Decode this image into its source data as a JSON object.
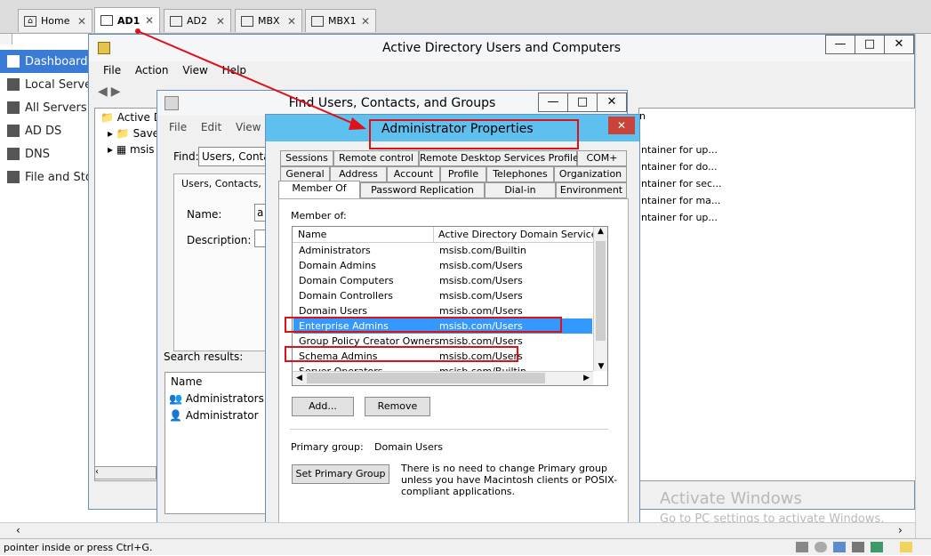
{
  "browser_tabs": [
    {
      "label": "Home",
      "active": false
    },
    {
      "label": "AD1",
      "active": true
    },
    {
      "label": "AD2",
      "active": false
    },
    {
      "label": "MBX",
      "active": false
    },
    {
      "label": "MBX1",
      "active": false
    }
  ],
  "sidebar": {
    "items": [
      {
        "label": "Dashboard",
        "selected": true
      },
      {
        "label": "Local Server"
      },
      {
        "label": "All Servers"
      },
      {
        "label": "AD DS"
      },
      {
        "label": "DNS"
      },
      {
        "label": "File and Storage Services"
      }
    ]
  },
  "aduc": {
    "title": "Active Directory Users and Computers",
    "menu": [
      "File",
      "Action",
      "View",
      "Help"
    ],
    "tree": [
      "Active D",
      "Save",
      "msis"
    ],
    "descriptions": [
      "ntainer for up...",
      "ntainer for do...",
      "ntainer for sec...",
      "ntainer for ma...",
      "ntainer for up..."
    ],
    "col_header": "n"
  },
  "find": {
    "title": "Find Users, Contacts, and Groups",
    "menu": [
      "File",
      "Edit",
      "View"
    ],
    "find_label": "Find:",
    "find_value": "Users, Contacts",
    "tab_label": "Users, Contacts, and",
    "name_label": "Name:",
    "name_value": "a",
    "description_label": "Description:",
    "results_label": "Search results:",
    "results_col": "Name",
    "results": [
      "Administrators",
      "Administrator"
    ]
  },
  "props": {
    "title": "Administrator Properties",
    "close": "✕",
    "tabs_row1": [
      "Sessions",
      "Remote control",
      "Remote Desktop Services Profile",
      "COM+"
    ],
    "tabs_row2": [
      "General",
      "Address",
      "Account",
      "Profile",
      "Telephones",
      "Organization"
    ],
    "tabs_row3": [
      "Member Of",
      "Password Replication",
      "Dial-in",
      "Environment"
    ],
    "member_of_label": "Member of:",
    "columns": [
      "Name",
      "Active Directory Domain Services Fo"
    ],
    "rows": [
      {
        "name": "Administrators",
        "folder": "msisb.com/Builtin",
        "selected": false
      },
      {
        "name": "Domain Admins",
        "folder": "msisb.com/Users",
        "selected": false
      },
      {
        "name": "Domain Computers",
        "folder": "msisb.com/Users",
        "selected": false
      },
      {
        "name": "Domain Controllers",
        "folder": "msisb.com/Users",
        "selected": false
      },
      {
        "name": "Domain Users",
        "folder": "msisb.com/Users",
        "selected": false
      },
      {
        "name": "Enterprise Admins",
        "folder": "msisb.com/Users",
        "selected": true
      },
      {
        "name": "Group Policy Creator Owners",
        "folder": "msisb.com/Users",
        "selected": false
      },
      {
        "name": "Schema Admins",
        "folder": "msisb.com/Users",
        "selected": false
      },
      {
        "name": "Server Operators",
        "folder": "msisb.com/Builtin",
        "selected": false
      }
    ],
    "add_label": "Add...",
    "remove_label": "Remove",
    "primary_group_label": "Primary group:",
    "primary_group_value": "Domain Users",
    "set_primary_label": "Set Primary Group",
    "note": "There is no need to change Primary group unless you have Macintosh clients or POSIX-compliant applications."
  },
  "watermark": {
    "line1": "Activate Windows",
    "line2": "Go to PC settings to activate Windows."
  },
  "status_text": "pointer inside or press Ctrl+G.",
  "colors": {
    "highlight": "#e0101a",
    "selection": "#3399ff",
    "dialog_title": "#5ec0ee"
  }
}
